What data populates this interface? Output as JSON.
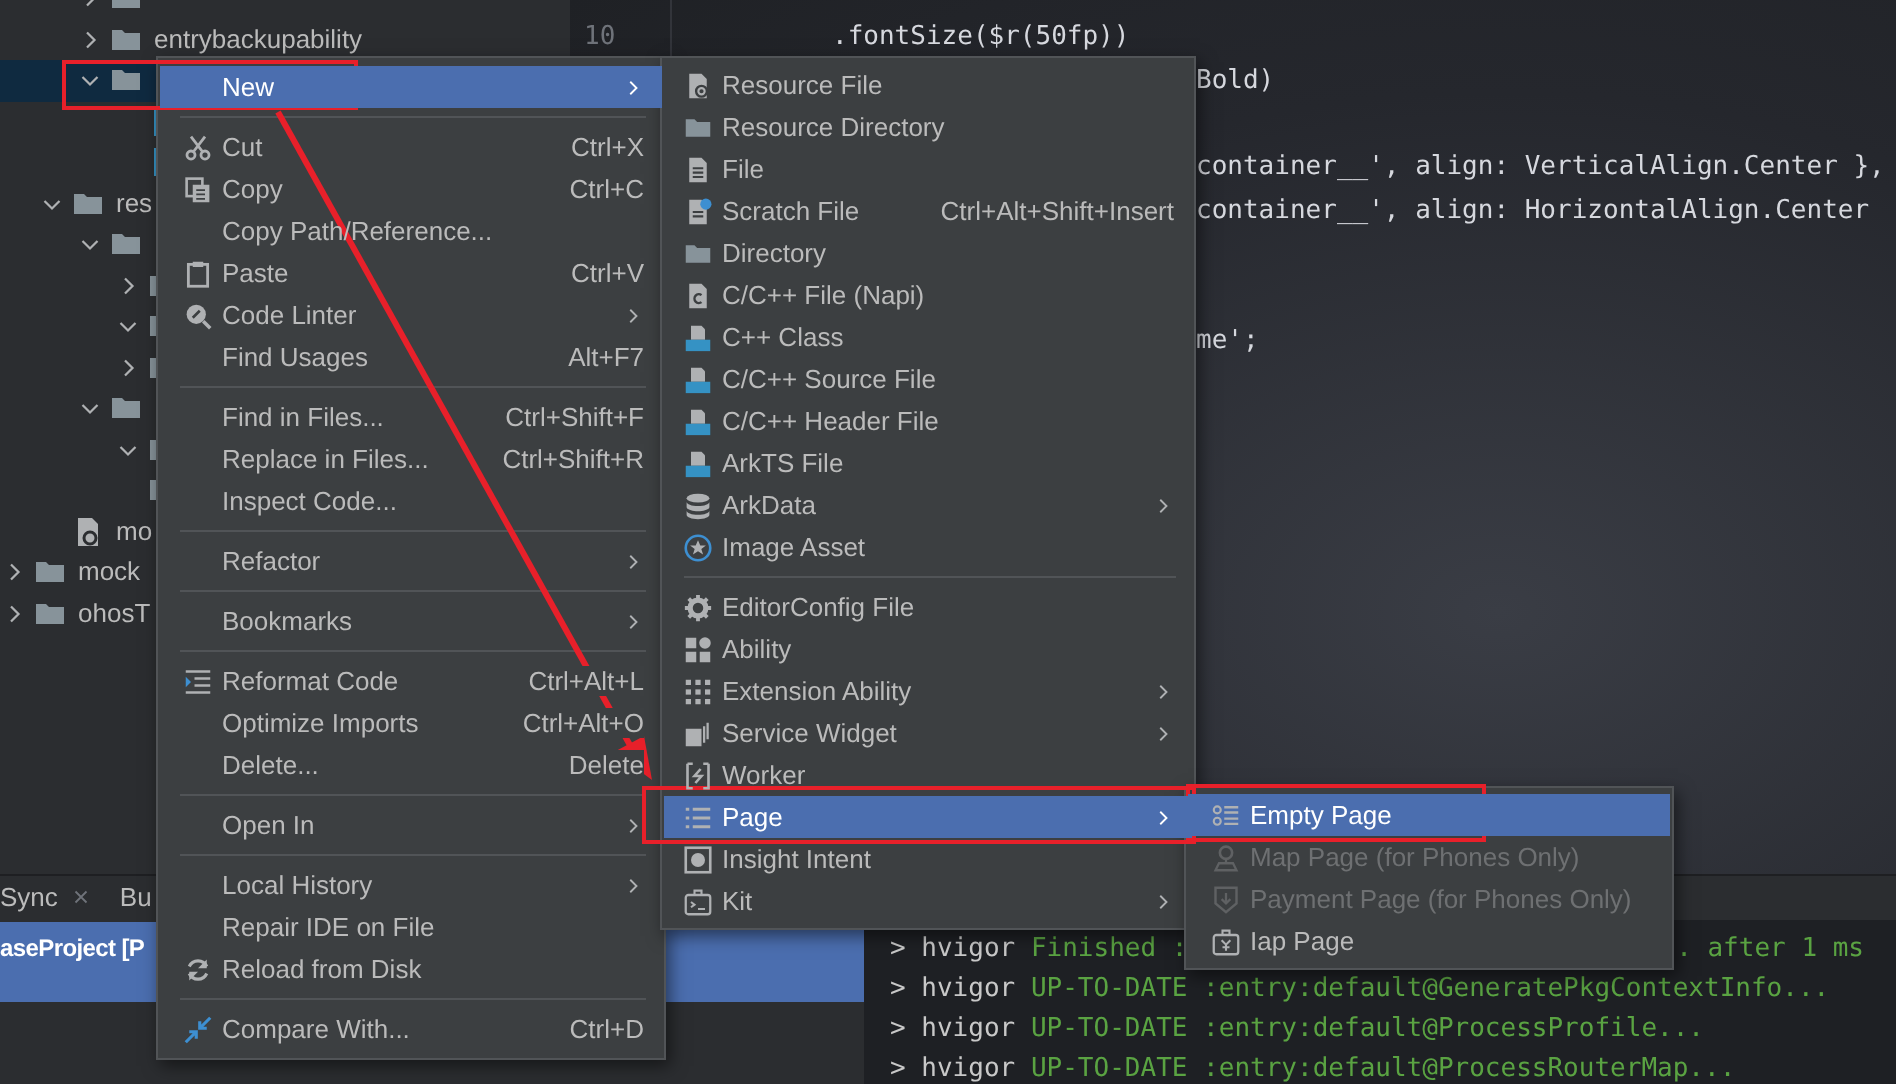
{
  "project_tree": [
    {
      "kind": "group",
      "children": [
        {
          "kind": "group",
          "children": [
            {
              "kind": "folder",
              "expanded": false,
              "selected": false
            },
            {
              "kind": "folder",
              "label": "entrybackupability",
              "expanded": false,
              "selected": false
            },
            {
              "kind": "folder",
              "expanded": true,
              "selected": true,
              "children": [
                {
                  "kind": "file",
                  "selected": false
                },
                {
                  "kind": "file",
                  "selected": false
                }
              ]
            }
          ]
        },
        {
          "kind": "folder",
          "label": "res",
          "expanded": true,
          "selected": false,
          "children": [
            {
              "kind": "folder",
              "expanded": true,
              "selected": false,
              "children": [
                {
                  "kind": "folder",
                  "expanded": false,
                  "selected": false
                },
                {
                  "kind": "folder",
                  "expanded": true,
                  "selected": false
                },
                {
                  "kind": "folder",
                  "expanded": false,
                  "selected": false
                }
              ]
            },
            {
              "kind": "folder",
              "expanded": true,
              "selected": false,
              "children": [
                {
                  "kind": "folder",
                  "expanded": true,
                  "selected": false
                },
                {
                  "kind": "folder",
                  "selected": false
                }
              ]
            }
          ]
        },
        {
          "kind": "config",
          "label": "mo",
          "selected": false
        }
      ]
    },
    {
      "kind": "folder",
      "label": "mock",
      "expanded": false,
      "selected": false
    },
    {
      "kind": "folder",
      "label": "ohosT",
      "expanded": false,
      "selected": false
    }
  ],
  "editor": {
    "lines": [
      {
        "number": "10",
        "code": ".fontSize($r(50fp))"
      },
      {
        "code": "Bold)"
      },
      {
        "code": "container__', align: VerticalAlign.Center },"
      },
      {
        "code": "container__', align: HorizontalAlign.Center"
      },
      {
        "code": "me';"
      }
    ]
  },
  "bottom_panel": {
    "tabs": [
      {
        "label": "Sync",
        "closable": true,
        "selected": false
      },
      {
        "label": "Bu",
        "selected": false
      }
    ],
    "build_tree": [
      {
        "label": "aseProject [P",
        "selected": true
      }
    ],
    "console": [
      {
        "prompt": "> hvigor",
        "text": "Finished :",
        "tail": ". after 1 ms"
      },
      {
        "prompt": "> hvigor",
        "text": "UP-TO-DATE :entry:default@GeneratePkgContextInfo..."
      },
      {
        "prompt": "> hvigor",
        "text": "UP-TO-DATE :entry:default@ProcessProfile..."
      },
      {
        "prompt": "> hvigor",
        "text": "UP-TO-DATE :entry:default@ProcessRouterMap..."
      }
    ]
  },
  "menus": [
    {
      "sections": [
        {
          "items": [
            {
              "label": "New",
              "submenu": true,
              "selected": true
            }
          ]
        },
        {
          "items": [
            {
              "label": "Cut",
              "shortcut": "Ctrl+X",
              "submenu": false,
              "selected": false
            },
            {
              "label": "Copy",
              "shortcut": "Ctrl+C",
              "submenu": false,
              "selected": false
            },
            {
              "label": "Copy Path/Reference...",
              "submenu": false,
              "selected": false
            },
            {
              "label": "Paste",
              "shortcut": "Ctrl+V",
              "submenu": false,
              "selected": false
            },
            {
              "label": "Code Linter",
              "submenu": true,
              "selected": false
            },
            {
              "label": "Find Usages",
              "shortcut": "Alt+F7",
              "submenu": false,
              "selected": false
            }
          ]
        },
        {
          "items": [
            {
              "label": "Find in Files...",
              "shortcut": "Ctrl+Shift+F",
              "submenu": false,
              "selected": false
            },
            {
              "label": "Replace in Files...",
              "shortcut": "Ctrl+Shift+R",
              "submenu": false,
              "selected": false
            },
            {
              "label": "Inspect Code...",
              "submenu": false,
              "selected": false
            }
          ]
        },
        {
          "items": [
            {
              "label": "Refactor",
              "submenu": true,
              "selected": false
            }
          ]
        },
        {
          "items": [
            {
              "label": "Bookmarks",
              "submenu": true,
              "selected": false
            }
          ]
        },
        {
          "items": [
            {
              "label": "Reformat Code",
              "shortcut": "Ctrl+Alt+L",
              "submenu": false,
              "selected": false
            },
            {
              "label": "Optimize Imports",
              "shortcut": "Ctrl+Alt+O",
              "submenu": false,
              "selected": false
            },
            {
              "label": "Delete...",
              "shortcut": "Delete",
              "submenu": false,
              "selected": false
            }
          ]
        },
        {
          "items": [
            {
              "label": "Open In",
              "submenu": true,
              "selected": false
            }
          ]
        },
        {
          "items": [
            {
              "label": "Local History",
              "submenu": true,
              "selected": false
            },
            {
              "label": "Repair IDE on File",
              "submenu": false,
              "selected": false
            },
            {
              "label": "Reload from Disk",
              "submenu": false,
              "selected": false
            }
          ]
        },
        {
          "items": [
            {
              "label": "Compare With...",
              "shortcut": "Ctrl+D",
              "submenu": false,
              "selected": false
            }
          ]
        }
      ]
    },
    {
      "sections": [
        {
          "items": [
            {
              "label": "Resource File",
              "submenu": false,
              "selected": false
            },
            {
              "label": "Resource Directory",
              "submenu": false,
              "selected": false
            },
            {
              "label": "File",
              "submenu": false,
              "selected": false
            },
            {
              "label": "Scratch File",
              "shortcut": "Ctrl+Alt+Shift+Insert",
              "submenu": false,
              "selected": false
            },
            {
              "label": "Directory",
              "submenu": false,
              "selected": false
            },
            {
              "label": "C/C++ File (Napi)",
              "submenu": false,
              "selected": false
            },
            {
              "label": "C++ Class",
              "submenu": false,
              "selected": false
            },
            {
              "label": "C/C++ Source File",
              "submenu": false,
              "selected": false
            },
            {
              "label": "C/C++ Header File",
              "submenu": false,
              "selected": false
            },
            {
              "label": "ArkTS File",
              "submenu": false,
              "selected": false
            },
            {
              "label": "ArkData",
              "submenu": true,
              "selected": false
            },
            {
              "label": "Image Asset",
              "submenu": false,
              "selected": false
            }
          ]
        },
        {
          "items": [
            {
              "label": "EditorConfig File",
              "submenu": false,
              "selected": false
            },
            {
              "label": "Ability",
              "submenu": false,
              "selected": false
            },
            {
              "label": "Extension Ability",
              "submenu": true,
              "selected": false
            },
            {
              "label": "Service Widget",
              "submenu": true,
              "selected": false
            },
            {
              "label": "Worker",
              "submenu": false,
              "selected": false
            },
            {
              "label": "Page",
              "submenu": true,
              "selected": true
            },
            {
              "label": "Insight Intent",
              "submenu": false,
              "selected": false
            },
            {
              "label": "Kit",
              "submenu": true,
              "selected": false
            }
          ]
        }
      ]
    },
    {
      "sections": [
        {
          "items": [
            {
              "label": "Empty Page",
              "submenu": false,
              "selected": true,
              "disabled": false
            },
            {
              "label": "Map Page (for Phones Only)",
              "submenu": false,
              "selected": false,
              "disabled": true
            },
            {
              "label": "Payment Page (for Phones Only)",
              "submenu": false,
              "selected": false,
              "disabled": true
            },
            {
              "label": "Iap Page",
              "submenu": false,
              "selected": false,
              "disabled": false
            }
          ]
        }
      ]
    }
  ]
}
